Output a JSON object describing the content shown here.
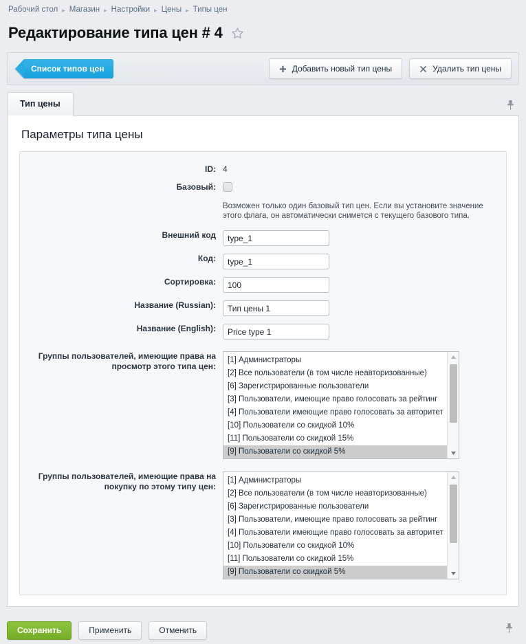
{
  "breadcrumb": {
    "items": [
      {
        "label": "Рабочий стол"
      },
      {
        "label": "Магазин"
      },
      {
        "label": "Настройки"
      },
      {
        "label": "Цены"
      },
      {
        "label": "Типы цен"
      }
    ],
    "separator": "▸"
  },
  "header": {
    "title": "Редактирование типа цен # 4",
    "favorite_icon": "star-icon"
  },
  "toolbar": {
    "back_label": "Список типов цен",
    "add_label": "Добавить новый тип цены",
    "add_icon": "plus-icon",
    "delete_label": "Удалить тип цены",
    "delete_icon": "close-icon"
  },
  "tabs": [
    {
      "label": "Тип цены",
      "active": true
    }
  ],
  "pin_icon": "pin-icon",
  "main": {
    "section_title": "Параметры типа цены",
    "fields": {
      "id": {
        "label": "ID:",
        "value": "4"
      },
      "base": {
        "label": "Базовый:",
        "checked": false
      },
      "base_hint": "Возможен только один базовый тип цен. Если вы установите значение этого флага, он автоматически снимется с текущего базового типа.",
      "external_code": {
        "label": "Внешний код",
        "value": "type_1",
        "placeholder": ""
      },
      "code": {
        "label": "Код:",
        "value": "type_1",
        "placeholder": ""
      },
      "sort": {
        "label": "Сортировка:",
        "value": "100",
        "placeholder": ""
      },
      "name_ru": {
        "label": "Название (Russian):",
        "value": "Тип цены 1",
        "placeholder": ""
      },
      "name_en": {
        "label": "Название (English):",
        "value": "Price type 1",
        "placeholder": ""
      }
    },
    "view_groups": {
      "label_line1": "Группы пользователей, имеющие права на",
      "label_line2": "просмотр этого типа цен:",
      "options": [
        {
          "label": "[1] Администраторы",
          "selected": false
        },
        {
          "label": "[2] Все пользователи (в том числе неавторизованные)",
          "selected": false
        },
        {
          "label": "[6] Зарегистрированные пользователи",
          "selected": false
        },
        {
          "label": "[3] Пользователи, имеющие право голосовать за рейтинг",
          "selected": false
        },
        {
          "label": "[4] Пользователи имеющие право голосовать за авторитет",
          "selected": false
        },
        {
          "label": "[10] Пользователи со скидкой 10%",
          "selected": false
        },
        {
          "label": "[11] Пользователи со скидкой 15%",
          "selected": false
        },
        {
          "label": "[9] Пользователи со скидкой 5%",
          "selected": true
        }
      ]
    },
    "buy_groups": {
      "label_line1": "Группы пользователей, имеющие права на",
      "label_line2": "покупку по этому типу цен:",
      "options": [
        {
          "label": "[1] Администраторы",
          "selected": false
        },
        {
          "label": "[2] Все пользователи (в том числе неавторизованные)",
          "selected": false
        },
        {
          "label": "[6] Зарегистрированные пользователи",
          "selected": false
        },
        {
          "label": "[3] Пользователи, имеющие право голосовать за рейтинг",
          "selected": false
        },
        {
          "label": "[4] Пользователи имеющие право голосовать за авторитет",
          "selected": false
        },
        {
          "label": "[10] Пользователи со скидкой 10%",
          "selected": false
        },
        {
          "label": "[11] Пользователи со скидкой 15%",
          "selected": false
        },
        {
          "label": "[9] Пользователи со скидкой 5%",
          "selected": true
        }
      ]
    }
  },
  "footer": {
    "save_label": "Сохранить",
    "apply_label": "Применить",
    "cancel_label": "Отменить"
  },
  "colors": {
    "accent_blue": "#27abe3",
    "primary_green": "#8cc63e",
    "page_bg": "#ebedf0",
    "selected_row": "#cdcdcd"
  }
}
